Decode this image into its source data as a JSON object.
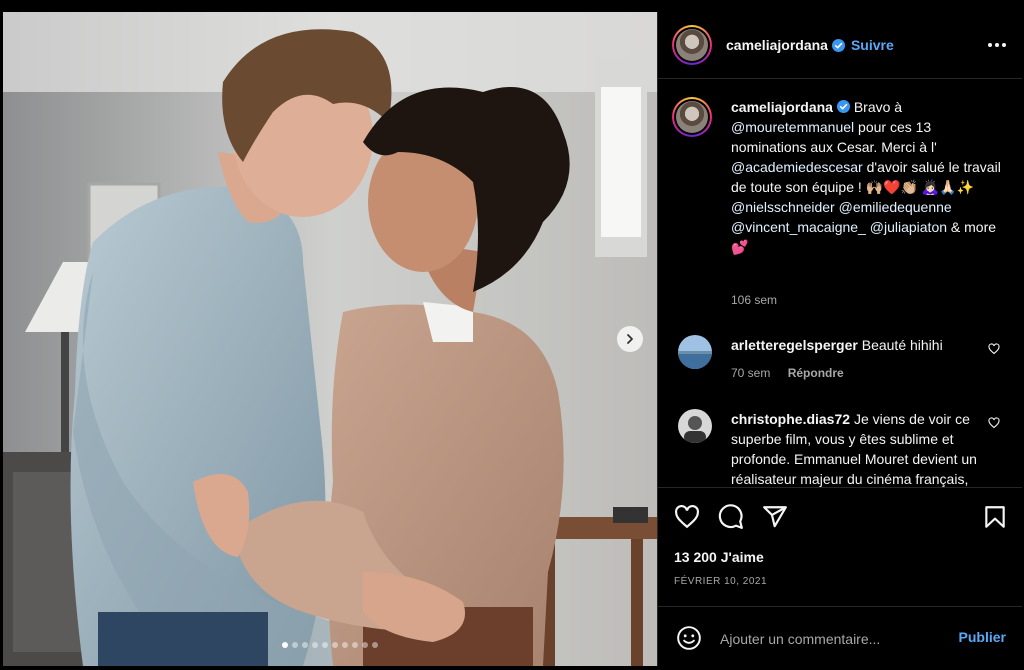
{
  "post": {
    "username": "cameliajordana",
    "follow_label": "Suivre",
    "caption_parts": {
      "text1": "Bravo à",
      "mention1": "@mouretemmanuel",
      "text2": "pour ces 13 nominations aux Cesar. Merci à l'",
      "mention2": "@academiedescesar",
      "text3": "d'avoir salué le travail de toute son équipe ! 🙌🏼❤️👏🏼 🙇🏻‍♀️🙏🏻✨",
      "mention3": "@nielsschneider",
      "mention4": "@emiliedequenne",
      "mention5": "@vincent_macaigne_",
      "mention6": "@juliapiaton",
      "text4": "& more 💕"
    },
    "caption_time": "106 sem",
    "likes": "13 200 J'aime",
    "date": "FÉVRIER 10, 2021",
    "carousel": {
      "total": 10,
      "active_index": 0
    }
  },
  "comments": [
    {
      "username": "arletteregelsperger",
      "text": "Beauté hihihi",
      "time": "70 sem",
      "reply_label": "Répondre"
    },
    {
      "username": "christophe.dias72",
      "text": "Je viens de voir ce superbe film, vous y êtes sublime et profonde. Emmanuel Mouret devient un réalisateur majeur du cinéma français, j'ai"
    }
  ],
  "composer": {
    "placeholder": "Ajouter un commentaire...",
    "publish_label": "Publier"
  },
  "icons": [
    "more-options-icon",
    "verified-icon",
    "heart-icon",
    "comment-icon",
    "share-icon",
    "bookmark-icon",
    "emoji-icon",
    "next-arrow-icon"
  ],
  "colors": {
    "background": "#000000",
    "link_blue": "#5aa9f7",
    "secondary_text": "#a8a8a8",
    "divider": "#262626"
  }
}
